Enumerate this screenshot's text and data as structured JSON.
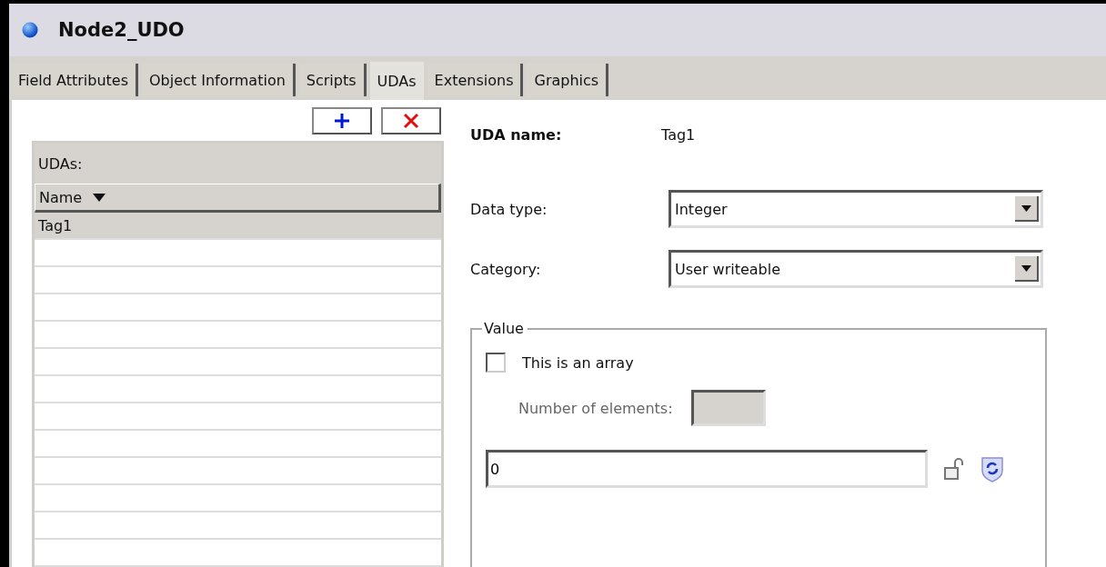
{
  "window": {
    "title": "Node2_UDO"
  },
  "tabs": [
    {
      "label": "Field Attributes",
      "selected": false
    },
    {
      "label": "Object Information",
      "selected": false
    },
    {
      "label": "Scripts",
      "selected": false
    },
    {
      "label": "UDAs",
      "selected": true
    },
    {
      "label": "Extensions",
      "selected": false
    },
    {
      "label": "Graphics",
      "selected": false
    }
  ],
  "udas_list": {
    "label": "UDAs:",
    "column": "Name",
    "rows": [
      {
        "name": "Tag1",
        "selected": true
      }
    ]
  },
  "uda_name": {
    "label": "UDA name:",
    "value": "Tag1"
  },
  "data_type": {
    "label": "Data type:",
    "value": "Integer"
  },
  "category": {
    "label": "Category:",
    "value": "User writeable"
  },
  "value_group": {
    "legend": "Value",
    "is_array": {
      "label": "This is an array",
      "checked": false
    },
    "number_of_elements": {
      "label": "Number of elements:",
      "disabled": true
    },
    "value": "0"
  }
}
